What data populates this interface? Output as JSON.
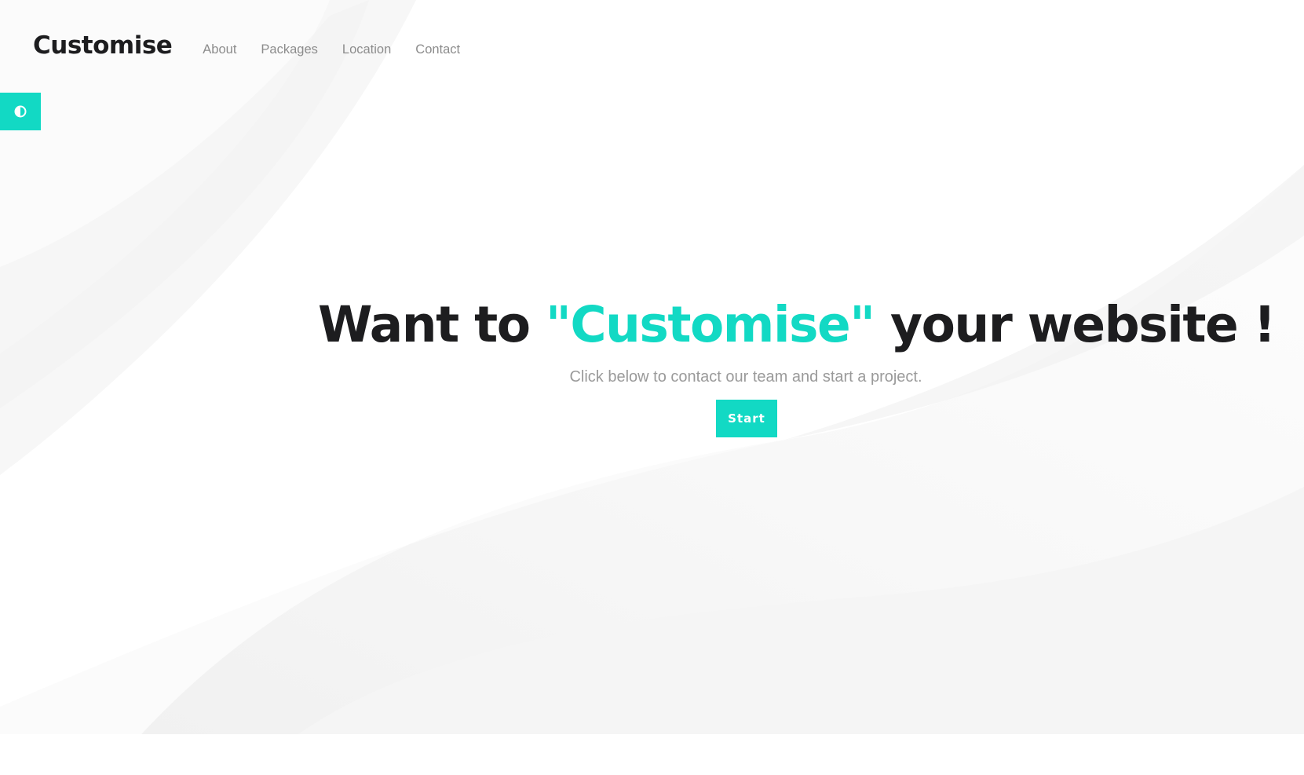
{
  "brand": {
    "logo_text": "Customise"
  },
  "nav": {
    "items": [
      {
        "label": "About"
      },
      {
        "label": "Packages"
      },
      {
        "label": "Location"
      },
      {
        "label": "Contact"
      }
    ]
  },
  "theme_toggle": {
    "icon": "contrast-icon"
  },
  "hero": {
    "headline_before": "Want to ",
    "headline_accent": "\"Customise\"",
    "headline_after": " your website !",
    "subtitle": "Click below to contact our team and start a project.",
    "cta_label": "Start"
  },
  "colors": {
    "accent": "#12d9c4",
    "text_dark": "#1d1d1f",
    "text_muted": "#9a9a9a",
    "background": "#ffffff"
  }
}
